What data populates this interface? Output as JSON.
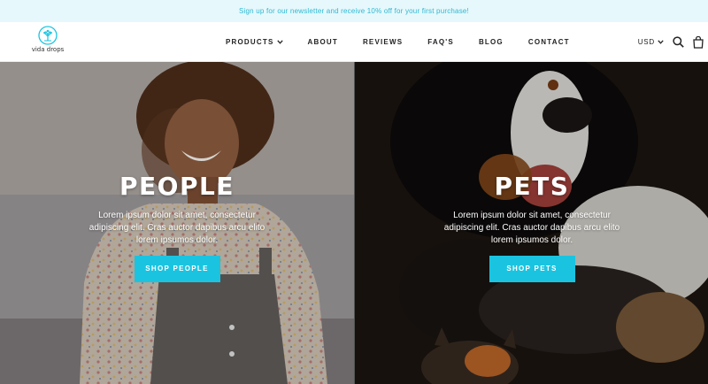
{
  "announcement": "Sign up for our newsletter and receive 10% off for your first purchase!",
  "brand": {
    "name": "vida drops"
  },
  "nav": {
    "items": [
      {
        "label": "PRODUCTS",
        "has_dropdown": true
      },
      {
        "label": "ABOUT"
      },
      {
        "label": "REVIEWS"
      },
      {
        "label": "FAQ'S"
      },
      {
        "label": "BLOG"
      },
      {
        "label": "CONTACT"
      }
    ]
  },
  "tools": {
    "currency": "USD",
    "icons": [
      "chevron-down-icon",
      "search-icon",
      "shopping-bag-icon"
    ]
  },
  "hero": {
    "people": {
      "title": "PEOPLE",
      "text": "Lorem ipsum dolor sit amet, consectetur adipiscing elit. Cras auctor dapibus arcu elito lorem ipsumos dolor.",
      "button": "SHOP PEOPLE"
    },
    "pets": {
      "title": "PETS",
      "text": "Lorem ipsum dolor sit amet, consectetur adipiscing elit. Cras auctor dapibus arcu elito lorem ipsumos dolor.",
      "button": "SHOP PETS"
    }
  },
  "colors": {
    "accent": "#1ac4e0",
    "announcement_bg": "#e6f8fb",
    "announcement_text": "#2fb8d3"
  }
}
